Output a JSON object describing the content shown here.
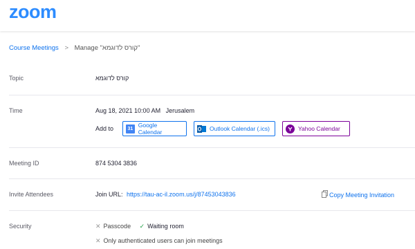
{
  "header": {
    "logo": "zoom"
  },
  "breadcrumb": {
    "parent": "Course Meetings",
    "separator": ">",
    "current": "Manage \"קורס לדוגמא\""
  },
  "topic": {
    "label": "Topic",
    "value": "קורס לדוגמא"
  },
  "time": {
    "label": "Time",
    "datetime": "Aug 18, 2021 10:00 AM",
    "timezone": "Jerusalem",
    "add_to": "Add to",
    "google": "Google Calendar",
    "google_icon_text": "31",
    "outlook": "Outlook Calendar (.ics)",
    "yahoo": "Yahoo Calendar"
  },
  "meeting_id": {
    "label": "Meeting ID",
    "value": "874 5304 3836"
  },
  "invite": {
    "label": "Invite Attendees",
    "join_prefix": "Join URL:",
    "url": "https://tau-ac-il.zoom.us/j/87453043836",
    "copy": "Copy Meeting Invitation"
  },
  "security": {
    "label": "Security",
    "passcode": "Passcode",
    "waiting_room": "Waiting room",
    "auth_only": "Only authenticated users can join meetings"
  },
  "colors": {
    "brand": "#2D8CFF",
    "link": "#0E72ED",
    "yahoo": "#7B0099",
    "check_on": "#23A047",
    "check_off": "#999999"
  }
}
